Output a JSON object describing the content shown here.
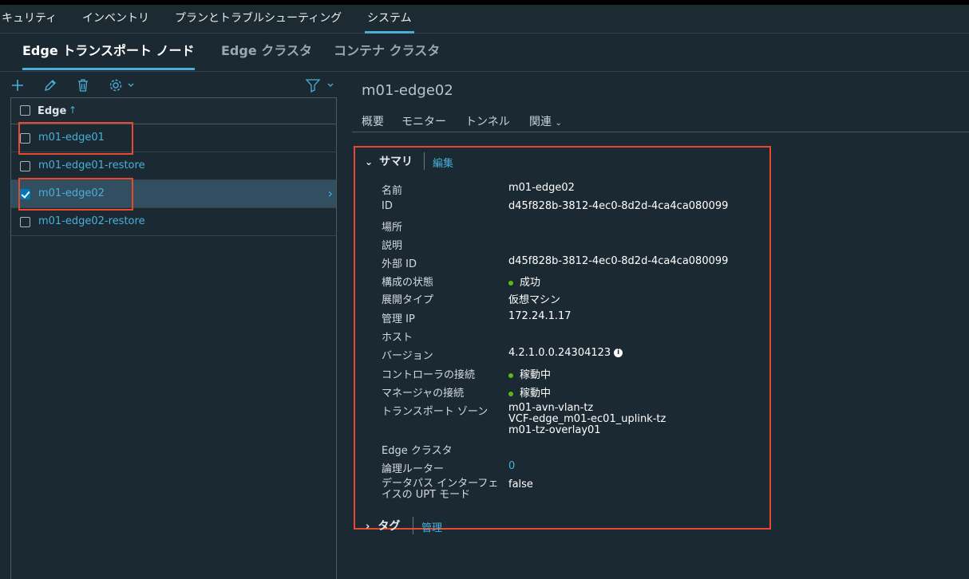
{
  "top_nav": {
    "tabs": [
      "キュリティ",
      "インベントリ",
      "プランとトラブルシューティング",
      "システム"
    ],
    "active": "システム"
  },
  "sub_nav": {
    "tabs": [
      "Edge トランスポート ノード",
      "Edge クラスタ",
      "コンテナ クラスタ"
    ],
    "active": "Edge トランスポート ノード"
  },
  "toolbar": {
    "icons": [
      "plus-icon",
      "pencil-icon",
      "trash-icon",
      "gear-icon",
      "filter-icon"
    ]
  },
  "grid": {
    "column_header": "Edge",
    "sort_indicator": "↑",
    "rows": [
      {
        "name": "m01-edge01",
        "checked": false,
        "selected": false
      },
      {
        "name": "m01-edge01-restore",
        "checked": false,
        "selected": false
      },
      {
        "name": "m01-edge02",
        "checked": true,
        "selected": true
      },
      {
        "name": "m01-edge02-restore",
        "checked": false,
        "selected": false
      }
    ]
  },
  "detail": {
    "title": "m01-edge02",
    "tabs": [
      "概要",
      "モニター",
      "トンネル",
      "関連"
    ],
    "summary": {
      "heading": "サマリ",
      "edit_label": "編集",
      "fields": {
        "name": {
          "label": "名前",
          "value": "m01-edge02"
        },
        "id": {
          "label": "ID",
          "value": "d45f828b-3812-4ec0-8d2d-4ca4ca080099"
        },
        "location": {
          "label": "場所",
          "value": ""
        },
        "description": {
          "label": "説明",
          "value": ""
        },
        "external_id": {
          "label": "外部 ID",
          "value": "d45f828b-3812-4ec0-8d2d-4ca4ca080099"
        },
        "config_state": {
          "label": "構成の状態",
          "value": "成功",
          "status_color": "#5eb715"
        },
        "deploy_type": {
          "label": "展開タイプ",
          "value": "仮想マシン"
        },
        "mgmt_ip": {
          "label": "管理 IP",
          "value": "172.24.1.17"
        },
        "host": {
          "label": "ホスト",
          "value": ""
        },
        "version": {
          "label": "バージョン",
          "value": "4.2.1.0.0.24304123"
        },
        "controller_conn": {
          "label": "コントローラの接続",
          "value": "稼動中",
          "status_color": "#5eb715"
        },
        "manager_conn": {
          "label": "マネージャの接続",
          "value": "稼動中",
          "status_color": "#5eb715"
        },
        "transport_zones": {
          "label": "トランスポート ゾーン",
          "values": [
            "m01-avn-vlan-tz",
            "VCF-edge_m01-ec01_uplink-tz",
            "m01-tz-overlay01"
          ]
        },
        "edge_cluster": {
          "label": "Edge クラスタ",
          "value": ""
        },
        "logical_routers": {
          "label": "論理ルーター",
          "value": "0"
        },
        "upt_mode": {
          "label_line1": "データパス インターフェ",
          "label_line2": "イスの UPT モード",
          "value": "false"
        }
      }
    },
    "tags": {
      "heading": "タグ",
      "manage_label": "管理"
    }
  },
  "colors": {
    "accent": "#49afd9",
    "highlight_box": "#e8482d",
    "background": "#1b2a32"
  }
}
